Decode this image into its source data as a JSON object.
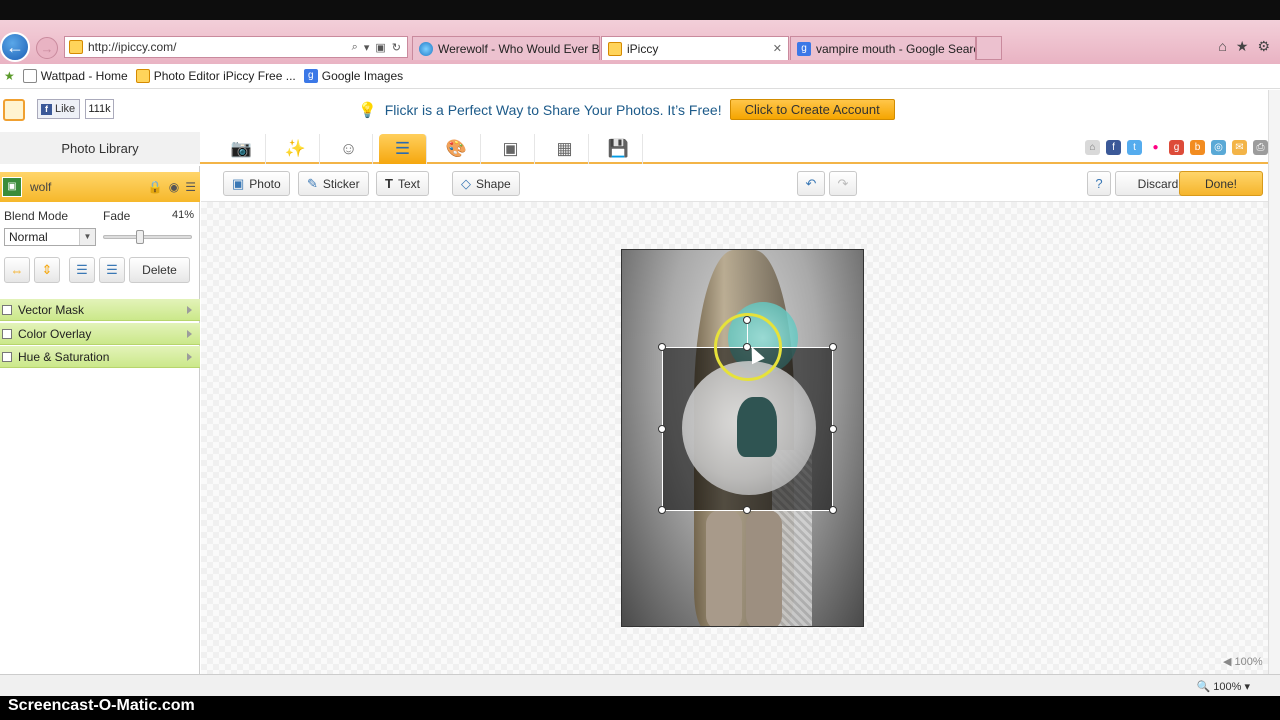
{
  "browser": {
    "address": "http://ipiccy.com/",
    "tabs": [
      {
        "label": "Werewolf - Who Would Ever B...",
        "active": false
      },
      {
        "label": "iPiccy",
        "active": true
      },
      {
        "label": "vampire mouth - Google Search",
        "active": false
      }
    ],
    "favorites": [
      "Wattpad - Home",
      "Photo Editor  iPiccy Free ...",
      "Google Images"
    ]
  },
  "header": {
    "fb_like": "Like",
    "fb_count": "111k",
    "promo_text": "Flickr is a Perfect Way to Share Your Photos. It’s Free!",
    "promo_button": "Click to Create Account"
  },
  "toolbar": {
    "photo_library": "Photo Library",
    "tabs": [
      "camera-icon",
      "magic-wand-icon",
      "face-icon",
      "layers-icon",
      "palette-icon",
      "frame-icon",
      "texture-icon",
      "save-icon"
    ]
  },
  "layer": {
    "name": "wolf",
    "blend_mode_label": "Blend Mode",
    "blend_mode": "Normal",
    "fade_label": "Fade",
    "fade_value": "41%",
    "fade_level": 0.41,
    "delete_label": "Delete",
    "effects": [
      "Vector Mask",
      "Color Overlay",
      "Hue & Saturation"
    ]
  },
  "edit": {
    "photo": "Photo",
    "sticker": "Sticker",
    "text": "Text",
    "shape": "Shape",
    "discard": "Discard",
    "done": "Done!"
  },
  "zoom": {
    "mini": "100%",
    "status": "100%"
  },
  "watermark": "Screencast-O-Matic.com",
  "colors": {
    "accent": "#f5a70e",
    "effects_green": "#cbe88a",
    "promo_text": "#1d5b8a"
  }
}
